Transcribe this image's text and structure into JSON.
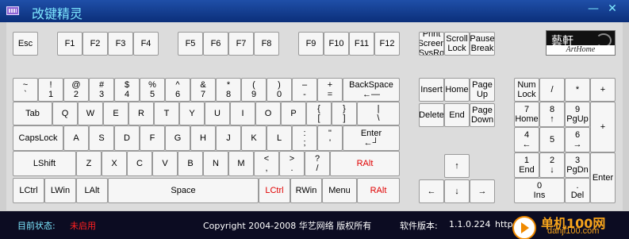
{
  "window": {
    "title": "改键精灵",
    "minimize_label": "—",
    "close_label": "✕"
  },
  "logo": {
    "text": "藝軒",
    "subtext": "ArtHome"
  },
  "keyboard": {
    "function_row": [
      {
        "name": "key-esc",
        "label": "Esc"
      },
      {
        "name": "key-f1",
        "label": "F1"
      },
      {
        "name": "key-f2",
        "label": "F2"
      },
      {
        "name": "key-f3",
        "label": "F3"
      },
      {
        "name": "key-f4",
        "label": "F4"
      },
      {
        "name": "key-f5",
        "label": "F5"
      },
      {
        "name": "key-f6",
        "label": "F6"
      },
      {
        "name": "key-f7",
        "label": "F7"
      },
      {
        "name": "key-f8",
        "label": "F8"
      },
      {
        "name": "key-f9",
        "label": "F9"
      },
      {
        "name": "key-f10",
        "label": "F10"
      },
      {
        "name": "key-f11",
        "label": "F11"
      },
      {
        "name": "key-f12",
        "label": "F12"
      }
    ],
    "control_row": [
      {
        "name": "key-printscreen",
        "label": "Print\nScreen\nSysRq"
      },
      {
        "name": "key-scrolllock",
        "label": "Scroll\nLock"
      },
      {
        "name": "key-pausebreak",
        "label": "Pause\nBreak"
      }
    ],
    "number_row": [
      {
        "name": "key-backtick",
        "label": "~\n`"
      },
      {
        "name": "key-1",
        "label": "!\n1"
      },
      {
        "name": "key-2",
        "label": "@\n2"
      },
      {
        "name": "key-3",
        "label": "#\n3"
      },
      {
        "name": "key-4",
        "label": "$\n4"
      },
      {
        "name": "key-5",
        "label": "%\n5"
      },
      {
        "name": "key-6",
        "label": "^\n6"
      },
      {
        "name": "key-7",
        "label": "&\n7"
      },
      {
        "name": "key-8",
        "label": "*\n8"
      },
      {
        "name": "key-9",
        "label": "(\n9"
      },
      {
        "name": "key-0",
        "label": ")\n0"
      },
      {
        "name": "key-minus",
        "label": "–\n-"
      },
      {
        "name": "key-equals",
        "label": "+\n="
      },
      {
        "name": "key-backspace",
        "label": "BackSpace\n←—"
      }
    ],
    "tab_row": [
      {
        "name": "key-tab",
        "label": "Tab"
      },
      {
        "name": "key-q",
        "label": "Q"
      },
      {
        "name": "key-w",
        "label": "W"
      },
      {
        "name": "key-e",
        "label": "E"
      },
      {
        "name": "key-r",
        "label": "R"
      },
      {
        "name": "key-t",
        "label": "T"
      },
      {
        "name": "key-y",
        "label": "Y"
      },
      {
        "name": "key-u",
        "label": "U"
      },
      {
        "name": "key-i",
        "label": "I"
      },
      {
        "name": "key-o",
        "label": "O"
      },
      {
        "name": "key-p",
        "label": "P"
      },
      {
        "name": "key-lbracket",
        "label": "{\n["
      },
      {
        "name": "key-rbracket",
        "label": "}\n]"
      },
      {
        "name": "key-backslash",
        "label": "|\n\\"
      }
    ],
    "caps_row": [
      {
        "name": "key-capslock",
        "label": "CapsLock"
      },
      {
        "name": "key-a",
        "label": "A"
      },
      {
        "name": "key-s",
        "label": "S"
      },
      {
        "name": "key-d",
        "label": "D"
      },
      {
        "name": "key-f",
        "label": "F"
      },
      {
        "name": "key-g",
        "label": "G"
      },
      {
        "name": "key-h",
        "label": "H"
      },
      {
        "name": "key-j",
        "label": "J"
      },
      {
        "name": "key-k",
        "label": "K"
      },
      {
        "name": "key-l",
        "label": "L"
      },
      {
        "name": "key-semicolon",
        "label": ":\n;"
      },
      {
        "name": "key-quote",
        "label": "\"\n'"
      },
      {
        "name": "key-enter",
        "label": "Enter\n←┘"
      }
    ],
    "shift_row": [
      {
        "name": "key-lshift",
        "label": "LShift"
      },
      {
        "name": "key-z",
        "label": "Z"
      },
      {
        "name": "key-x",
        "label": "X"
      },
      {
        "name": "key-c",
        "label": "C"
      },
      {
        "name": "key-v",
        "label": "V"
      },
      {
        "name": "key-b",
        "label": "B"
      },
      {
        "name": "key-n",
        "label": "N"
      },
      {
        "name": "key-m",
        "label": "M"
      },
      {
        "name": "key-comma",
        "label": "<\n,"
      },
      {
        "name": "key-period",
        "label": ">\n."
      },
      {
        "name": "key-slash",
        "label": "?\n/"
      },
      {
        "name": "key-ralt-shiftrow",
        "label": "RAlt"
      }
    ],
    "bottom_row": [
      {
        "name": "key-lctrl",
        "label": "LCtrl"
      },
      {
        "name": "key-lwin",
        "label": "LWin"
      },
      {
        "name": "key-lalt",
        "label": "LAlt"
      },
      {
        "name": "key-space",
        "label": "Space"
      },
      {
        "name": "key-lctrl-right",
        "label": "LCtrl"
      },
      {
        "name": "key-rwin",
        "label": "RWin"
      },
      {
        "name": "key-menu",
        "label": "Menu"
      },
      {
        "name": "key-ralt",
        "label": "RAlt"
      }
    ],
    "nav_keys": [
      {
        "name": "key-insert",
        "label": "Insert"
      },
      {
        "name": "key-home",
        "label": "Home"
      },
      {
        "name": "key-pageup",
        "label": "Page\nUp"
      },
      {
        "name": "key-delete",
        "label": "Delete"
      },
      {
        "name": "key-end",
        "label": "End"
      },
      {
        "name": "key-pagedown",
        "label": "Page\nDown"
      }
    ],
    "arrow_keys": [
      {
        "name": "key-arrow-up",
        "label": "↑"
      },
      {
        "name": "key-arrow-left",
        "label": "←"
      },
      {
        "name": "key-arrow-down",
        "label": "↓"
      },
      {
        "name": "key-arrow-right",
        "label": "→"
      }
    ],
    "numpad": [
      {
        "name": "key-numlock",
        "label": "Num\nLock"
      },
      {
        "name": "key-num-divide",
        "label": "/"
      },
      {
        "name": "key-num-multiply",
        "label": "*"
      },
      {
        "name": "key-num-plus-top",
        "label": "+"
      },
      {
        "name": "key-num-7",
        "label": "7\nHome"
      },
      {
        "name": "key-num-8",
        "label": "8\n↑"
      },
      {
        "name": "key-num-9",
        "label": "9\nPgUp"
      },
      {
        "name": "key-num-plus",
        "label": "+"
      },
      {
        "name": "key-num-4",
        "label": "4\n←"
      },
      {
        "name": "key-num-5",
        "label": "5"
      },
      {
        "name": "key-num-6",
        "label": "6\n→"
      },
      {
        "name": "key-num-1",
        "label": "1\nEnd"
      },
      {
        "name": "key-num-2",
        "label": "2\n↓"
      },
      {
        "name": "key-num-3",
        "label": "3\nPgDn"
      },
      {
        "name": "key-num-enter",
        "label": "Enter"
      },
      {
        "name": "key-num-0",
        "label": "0\nIns"
      },
      {
        "name": "key-num-dot",
        "label": ".\nDel"
      }
    ]
  },
  "status": {
    "state_label": "目前状态:",
    "state_value": "未启用",
    "copyright": "Copyright 2004-2008 华艺网络 版权所有",
    "version_label": "软件版本:",
    "version_value": "1.1.0.224",
    "url_partial": "http://w"
  },
  "watermark": {
    "brand": "单机100网",
    "url": "danji100.com"
  },
  "colors": {
    "title_text": "#7ee8ff",
    "status_label": "#7ee8ff",
    "status_value": "#ff2020",
    "text_white": "#ffffff",
    "red_key": "#e00000",
    "watermark": "#f7a41c"
  }
}
